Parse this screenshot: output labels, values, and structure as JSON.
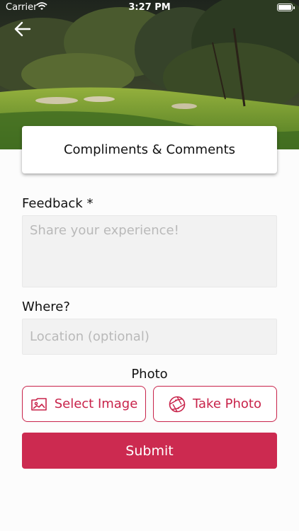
{
  "status_bar": {
    "carrier": "Carrier",
    "time": "3:27 PM"
  },
  "header": {
    "back_icon": "arrow-left-icon",
    "title": "Compliments & Comments"
  },
  "form": {
    "feedback_label": "Feedback *",
    "feedback_placeholder": "Share your experience!",
    "where_label": "Where?",
    "where_placeholder": "Location (optional)",
    "photo_label": "Photo",
    "select_image_label": "Select Image",
    "select_image_icon": "image-icon",
    "take_photo_label": "Take Photo",
    "take_photo_icon": "camera-aperture-icon",
    "submit_label": "Submit"
  },
  "colors": {
    "accent": "#cc2a50",
    "field_bg": "#f2f2f2",
    "placeholder": "#b9b9b9"
  }
}
